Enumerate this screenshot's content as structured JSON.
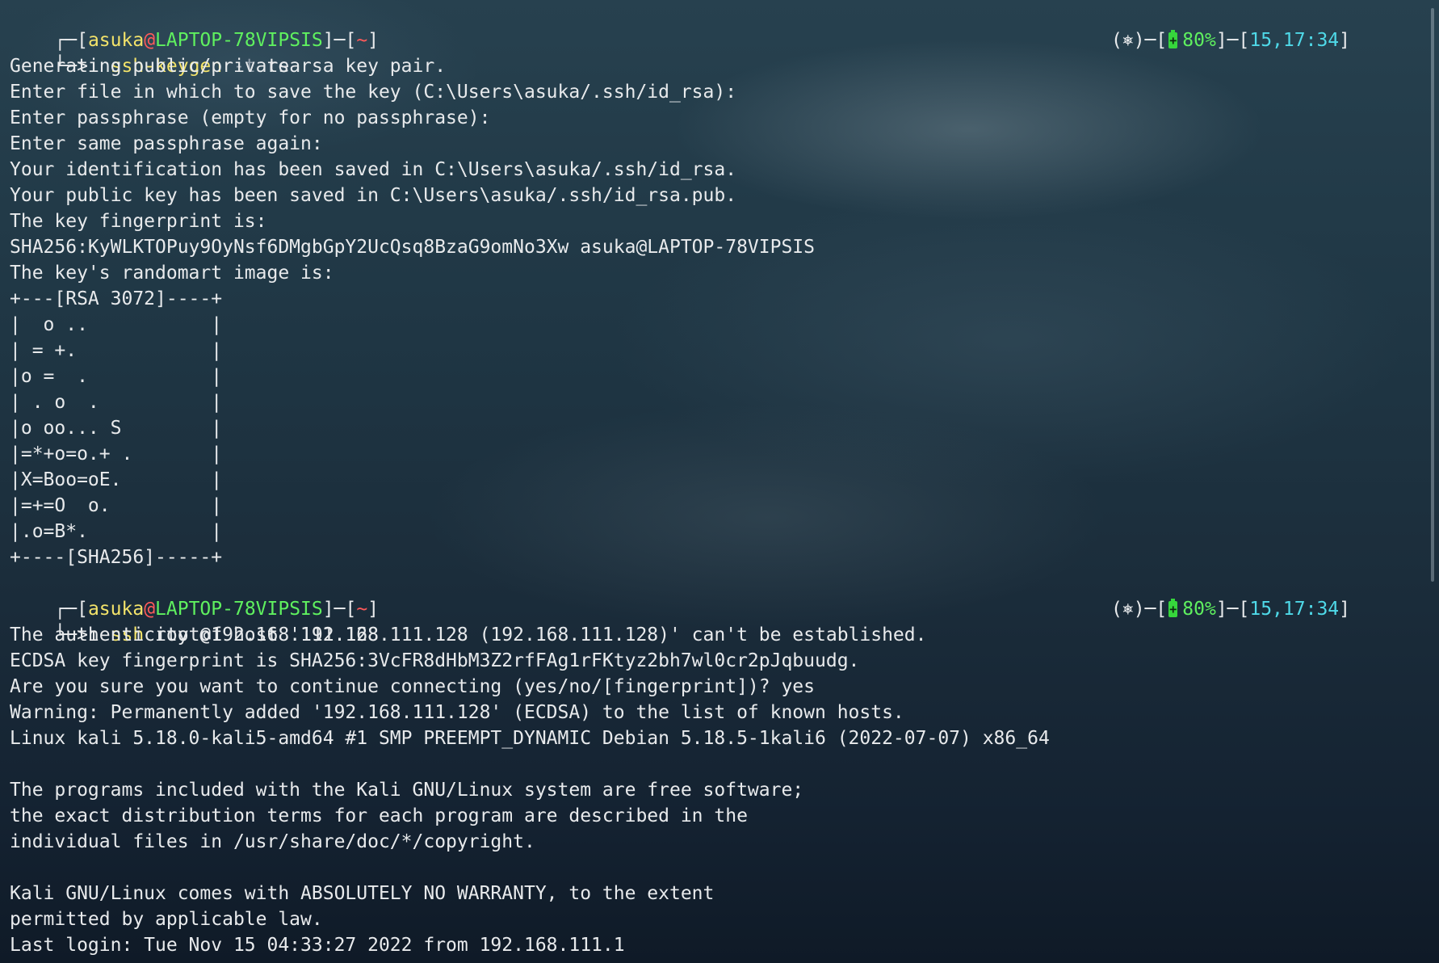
{
  "prompt": {
    "user": "asuka",
    "at": "@",
    "host": "LAPTOP-78VIPSIS",
    "dir": "~",
    "open_bracket": "┌─[",
    "close_bracket": "]─[",
    "end_bracket": "]",
    "arrow": "└─>ı",
    "status_icon": "⎈",
    "battery_pct": "80%",
    "time": "15,17:34"
  },
  "commands": {
    "keygen_cmd": "ssh-keygen",
    "keygen_flag": "-t",
    "keygen_arg": "rsa",
    "ssh_cmd": "ssh",
    "ssh_arg": "root@192.168.111.128"
  },
  "keygen_output": [
    "Generating public/private rsa key pair.",
    "Enter file in which to save the key (C:\\Users\\asuka/.ssh/id_rsa):",
    "Enter passphrase (empty for no passphrase):",
    "Enter same passphrase again:",
    "Your identification has been saved in C:\\Users\\asuka/.ssh/id_rsa.",
    "Your public key has been saved in C:\\Users\\asuka/.ssh/id_rsa.pub.",
    "The key fingerprint is:",
    "SHA256:KyWLKTOPuy9OyNsf6DMgbGpY2UcQsq8BzaG9omNo3Xw asuka@LAPTOP-78VIPSIS",
    "The key's randomart image is:",
    "+---[RSA 3072]----+",
    "|  o ..           |",
    "| = +.            |",
    "|o =  .           |",
    "| . o  .          |",
    "|o oo... S        |",
    "|=*+o=o.+ .       |",
    "|X=Boo=oE.        |",
    "|=+=O  o.         |",
    "|.o=B*.           |",
    "+----[SHA256]-----+"
  ],
  "ssh_output": [
    "The authenticity of host '192.168.111.128 (192.168.111.128)' can't be established.",
    "ECDSA key fingerprint is SHA256:3VcFR8dHbM3Z2rfFAg1rFKtyz2bh7wl0cr2pJqbuudg.",
    "Are you sure you want to continue connecting (yes/no/[fingerprint])? yes",
    "Warning: Permanently added '192.168.111.128' (ECDSA) to the list of known hosts.",
    "Linux kali 5.18.0-kali5-amd64 #1 SMP PREEMPT_DYNAMIC Debian 5.18.5-1kali6 (2022-07-07) x86_64",
    "",
    "The programs included with the Kali GNU/Linux system are free software;",
    "the exact distribution terms for each program are described in the",
    "individual files in /usr/share/doc/*/copyright.",
    "",
    "Kali GNU/Linux comes with ABSOLUTELY NO WARRANTY, to the extent",
    "permitted by applicable law.",
    "Last login: Tue Nov 15 04:33:27 2022 from 192.168.111.1"
  ]
}
